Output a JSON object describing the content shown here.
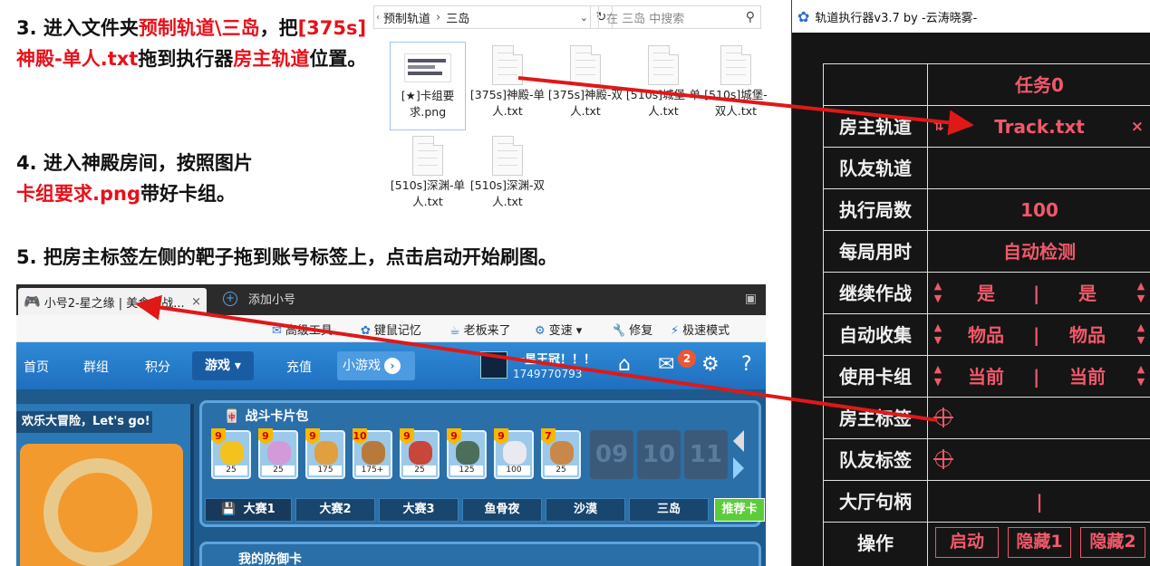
{
  "instructions": {
    "step3": {
      "a": "3. 进入文件夹",
      "b": "预制轨道\\三岛",
      "c": "，把",
      "d": "[375s]神殿-单人.txt",
      "e": "拖到执行器",
      "f": "房主轨道",
      "g": "位置。"
    },
    "step4": {
      "a": "4. 进入神殿房间，按照图片",
      "b": "卡组要求.png",
      "c": "带好卡组。"
    },
    "step5": "5. 把房主标签左侧的靶子拖到账号标签上，点击启动开始刷图。"
  },
  "explorer": {
    "breadcrumb": [
      "预制轨道",
      "三岛"
    ],
    "search_placeholder": "在 三岛 中搜索",
    "files": [
      {
        "name": "[★]卡组要求.png"
      },
      {
        "name": "[375s]神殿-单人.txt"
      },
      {
        "name": "[375s]神殿-双人.txt"
      },
      {
        "name": "[510s]城堡-单人.txt"
      },
      {
        "name": "[510s]城堡-双人.txt"
      },
      {
        "name": "[510s]深渊-单人.txt"
      },
      {
        "name": "[510s]深渊-双人.txt"
      }
    ]
  },
  "browser": {
    "active_tab": "小号2-星之缘 | 美食大战...",
    "add_tab": "添加小号",
    "toolbar": [
      "高级工具",
      "键鼠记忆",
      "老板来了",
      "变速",
      "修复",
      "极速模式"
    ],
    "nav": [
      "首页",
      "群组",
      "积分",
      "游戏",
      "充值",
      "小游戏"
    ],
    "user_name": "一星王冠！！！",
    "user_id": "1749770793",
    "mail_badge": "2",
    "left_banner": "欢乐大冒险，Let's go!",
    "cards_title": "战斗卡片包",
    "cards": [
      {
        "level": "9",
        "cost": "25",
        "color": "#f3c21f"
      },
      {
        "level": "9",
        "cost": "25",
        "color": "#d29ad8"
      },
      {
        "level": "9",
        "cost": "175",
        "color": "#e0a040"
      },
      {
        "level": "10",
        "cost": "175+",
        "color": "#b87a3a"
      },
      {
        "level": "9",
        "cost": "25",
        "color": "#c8463a"
      },
      {
        "level": "9",
        "cost": "125",
        "color": "#4b6f5a"
      },
      {
        "level": "9",
        "cost": "100",
        "color": "#e9e9ef"
      },
      {
        "level": "7",
        "cost": "25",
        "color": "#c9884a"
      }
    ],
    "empty_slots": [
      "09",
      "10",
      "11"
    ],
    "map_tabs": [
      "大赛1",
      "大赛2",
      "大赛3",
      "鱼骨夜",
      "沙漠",
      "三岛"
    ],
    "recommend": "推荐卡",
    "defense_title": "我的防御卡"
  },
  "executor": {
    "title": "轨道执行器v3.7 by -云涛晓雾-",
    "task": "任务0",
    "rows": {
      "host_track": {
        "label": "房主轨道",
        "value": "Track.txt"
      },
      "mate_track": {
        "label": "队友轨道"
      },
      "rounds": {
        "label": "执行局数",
        "value": "100"
      },
      "time": {
        "label": "每局用时",
        "value": "自动检测"
      },
      "continue": {
        "label": "继续作战",
        "left": "是",
        "right": "是"
      },
      "collect": {
        "label": "自动收集",
        "left": "物品",
        "right": "物品"
      },
      "deck": {
        "label": "使用卡组",
        "left": "当前",
        "right": "当前"
      },
      "host_tag": {
        "label": "房主标签"
      },
      "mate_tag": {
        "label": "队友标签"
      },
      "hall": {
        "label": "大厅句柄",
        "value": "|"
      },
      "ops": {
        "label": "操作",
        "start": "启动",
        "hide1": "隐藏1",
        "hide2": "隐藏2"
      }
    },
    "divider": "|",
    "remove": "×",
    "swap": "⇅"
  },
  "colors": {
    "accent": "#f0596a",
    "instruction_red": "#e8101a",
    "arrow_red": "#e01818"
  }
}
